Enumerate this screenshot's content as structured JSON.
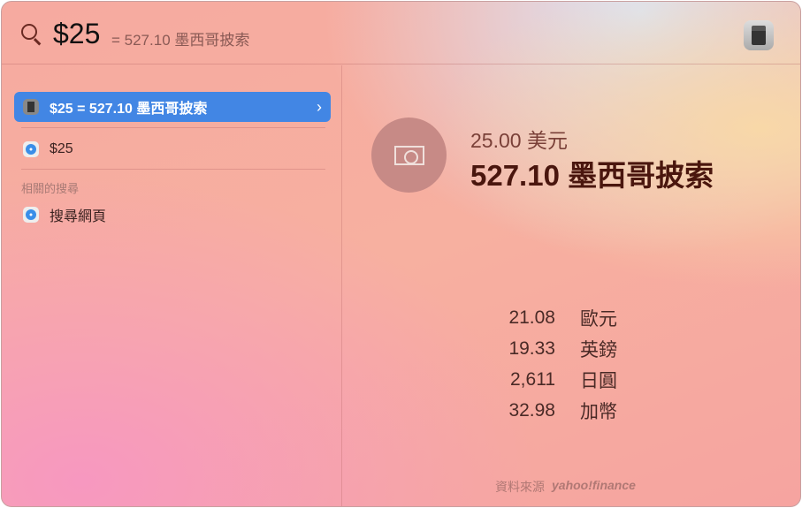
{
  "search": {
    "query": "$25",
    "hint": "= 527.10 墨西哥披索"
  },
  "results": [
    {
      "label": "$25 = 527.10 墨西哥披索",
      "icon": "calculator"
    },
    {
      "label": "$25",
      "icon": "safari"
    }
  ],
  "related": {
    "heading": "相關的搜尋",
    "items": [
      {
        "label": "搜尋網頁",
        "icon": "safari"
      }
    ]
  },
  "detail": {
    "from": "25.00 美元",
    "to": "527.10 墨西哥披索",
    "rates": [
      {
        "value": "21.08",
        "name": "歐元"
      },
      {
        "value": "19.33",
        "name": "英鎊"
      },
      {
        "value": "2,611",
        "name": "日圓"
      },
      {
        "value": "32.98",
        "name": "加幣"
      }
    ],
    "source_label": "資料來源",
    "source_brand": "yahoo!finance"
  }
}
